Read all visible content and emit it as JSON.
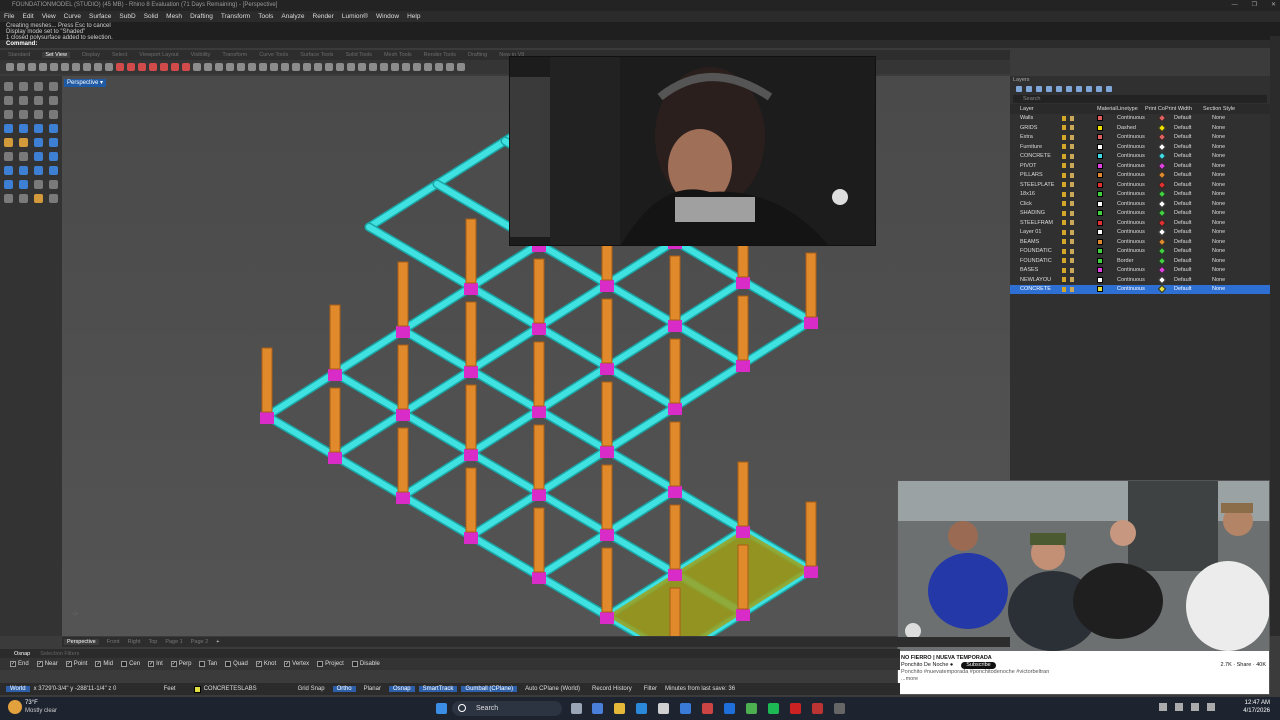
{
  "window": {
    "title": "FOUNDATIONMODEL (STUDIO) (45 MB) - Rhino 8 Evaluation (71 Days Remaining) - [Perspective]",
    "controls": [
      "—",
      "❐",
      "✕"
    ]
  },
  "menu": [
    "File",
    "Edit",
    "View",
    "Curve",
    "Surface",
    "SubD",
    "Solid",
    "Mesh",
    "Drafting",
    "Transform",
    "Tools",
    "Analyze",
    "Render",
    "Lumion®",
    "Window",
    "Help"
  ],
  "command_history": [
    "Creating meshes... Press Esc to cancel",
    "Display mode set to \"Shaded\"",
    "1 closed polysurface added to selection."
  ],
  "command_prompt": "Command:",
  "toolbar_tabs": [
    "Standard",
    "Set View",
    "Display",
    "Select",
    "Viewport Layout",
    "Visibility",
    "Transform",
    "Curve Tools",
    "Surface Tools",
    "Solid Tools",
    "Mesh Tools",
    "Render Tools",
    "Drafting",
    "New in V8"
  ],
  "active_toolbar_tab": "Set View",
  "viewport": {
    "name": "Perspective",
    "dropdown": "▾"
  },
  "layers_panel": {
    "title": "Layers",
    "search_placeholder": "Search",
    "headers": [
      "Layer",
      "Material",
      "Linetype",
      "Print Color",
      "Print Width",
      "Section Style"
    ],
    "rows": [
      {
        "name": "Walls",
        "color": "#e06060",
        "linetype": "Continuous",
        "print_color": "#e06060",
        "print_width": "Default",
        "section": "None"
      },
      {
        "name": "GRIDS",
        "color": "#f0e000",
        "linetype": "Dashed",
        "print_color": "#f0e000",
        "print_width": "Default",
        "section": "None"
      },
      {
        "name": "Extra",
        "color": "#e06060",
        "linetype": "Continuous",
        "print_color": "#e06060",
        "print_width": "Default",
        "section": "None"
      },
      {
        "name": "Furniture",
        "color": "#ffffff",
        "linetype": "Continuous",
        "print_color": "#ffffff",
        "print_width": "Default",
        "section": "None"
      },
      {
        "name": "CONCRETE",
        "color": "#40d8e0",
        "linetype": "Continuous",
        "print_color": "#40d8e0",
        "print_width": "Default",
        "section": "None"
      },
      {
        "name": "PIVOT",
        "color": "#e040e0",
        "linetype": "Continuous",
        "print_color": "#e040e0",
        "print_width": "Default",
        "section": "None"
      },
      {
        "name": "PILLARS",
        "color": "#e08a30",
        "linetype": "Continuous",
        "print_color": "#e08a30",
        "print_width": "Default",
        "section": "None"
      },
      {
        "name": "STEELPLATE",
        "color": "#e03030",
        "linetype": "Continuous",
        "print_color": "#e03030",
        "print_width": "Default",
        "section": "None"
      },
      {
        "name": "18x16",
        "color": "#40d040",
        "linetype": "Continuous",
        "print_color": "#40d040",
        "print_width": "Default",
        "section": "None"
      },
      {
        "name": "Click",
        "color": "#ffffff",
        "linetype": "Continuous",
        "print_color": "#ffffff",
        "print_width": "Default",
        "section": "None"
      },
      {
        "name": "SHADING",
        "color": "#40d040",
        "linetype": "Continuous",
        "print_color": "#40d040",
        "print_width": "Default",
        "section": "None"
      },
      {
        "name": "STEELFRAM",
        "color": "#e03030",
        "linetype": "Continuous",
        "print_color": "#e03030",
        "print_width": "Default",
        "section": "None"
      },
      {
        "name": "Layer 01",
        "color": "#ffffff",
        "linetype": "Continuous",
        "print_color": "#ffffff",
        "print_width": "Default",
        "section": "None"
      },
      {
        "name": "BEAMS",
        "color": "#e08a30",
        "linetype": "Continuous",
        "print_color": "#e08a30",
        "print_width": "Default",
        "section": "None"
      },
      {
        "name": "FOUNDATIC",
        "color": "#40d040",
        "linetype": "Continuous",
        "print_color": "#40d040",
        "print_width": "Default",
        "section": "None"
      },
      {
        "name": "FOUNDATIC",
        "color": "#40d040",
        "linetype": "Border",
        "print_color": "#40d040",
        "print_width": "Default",
        "section": "None"
      },
      {
        "name": "BASES",
        "color": "#e040e0",
        "linetype": "Continuous",
        "print_color": "#e040e0",
        "print_width": "Default",
        "section": "None"
      },
      {
        "name": "NEWLAYOU",
        "color": "#ffffff",
        "linetype": "Continuous",
        "print_color": "#ffffff",
        "print_width": "Default",
        "section": "None"
      },
      {
        "name": "CONCRETE",
        "color": "#e0e040",
        "linetype": "Continuous",
        "print_color": "#e0e040",
        "print_width": "Default",
        "section": "None",
        "selected": true
      }
    ]
  },
  "viewport_tabs": [
    "Perspective",
    "Front",
    "Right",
    "Top",
    "Page 1",
    "Page 2",
    "+"
  ],
  "osnap": {
    "tabs": [
      "Osnap",
      "Selection Filters"
    ],
    "items": [
      {
        "label": "End",
        "checked": true
      },
      {
        "label": "Near",
        "checked": true
      },
      {
        "label": "Point",
        "checked": true
      },
      {
        "label": "Mid",
        "checked": true
      },
      {
        "label": "Cen",
        "checked": false
      },
      {
        "label": "Int",
        "checked": true
      },
      {
        "label": "Perp",
        "checked": true
      },
      {
        "label": "Tan",
        "checked": false
      },
      {
        "label": "Quad",
        "checked": false
      },
      {
        "label": "Knot",
        "checked": true
      },
      {
        "label": "Vertex",
        "checked": true
      },
      {
        "label": "Project",
        "checked": false
      },
      {
        "label": "Disable",
        "checked": false
      }
    ]
  },
  "status": {
    "cplane": "World",
    "coords": "x 3729'0-3/4\"   y -288'11-1/4\"   z 0",
    "units": "Feet",
    "layer": "CONCRETESLABS",
    "layer_color": "#e0e040",
    "buttons": [
      {
        "label": "Grid Snap",
        "on": false
      },
      {
        "label": "Ortho",
        "on": true
      },
      {
        "label": "Planar",
        "on": false
      },
      {
        "label": "Osnap",
        "on": true
      },
      {
        "label": "SmartTrack",
        "on": true
      },
      {
        "label": "Gumball (CPlane)",
        "on": true
      },
      {
        "label": "Auto CPlane (World)",
        "on": false
      },
      {
        "label": "Record History",
        "on": false
      },
      {
        "label": "Filter",
        "on": false
      }
    ],
    "minutes": "Minutes from last save: 36"
  },
  "video_overlay": {
    "title": "NO FIERRO | NUEVA TEMPORADA",
    "channel": "Ponchito De Noche ●",
    "subscribe": "Subscribe",
    "description_line1": "Ponchito #nuevatemporada #ponchitodenoche #victorbeltran",
    "description_line2": "...more",
    "stats": "2.7K  ·  Share  ·  40K"
  },
  "taskbar": {
    "weather_temp": "73°F",
    "weather_desc": "Mostly clear",
    "search": "Search",
    "time": "12:47 AM",
    "date": "4/17/2026"
  }
}
